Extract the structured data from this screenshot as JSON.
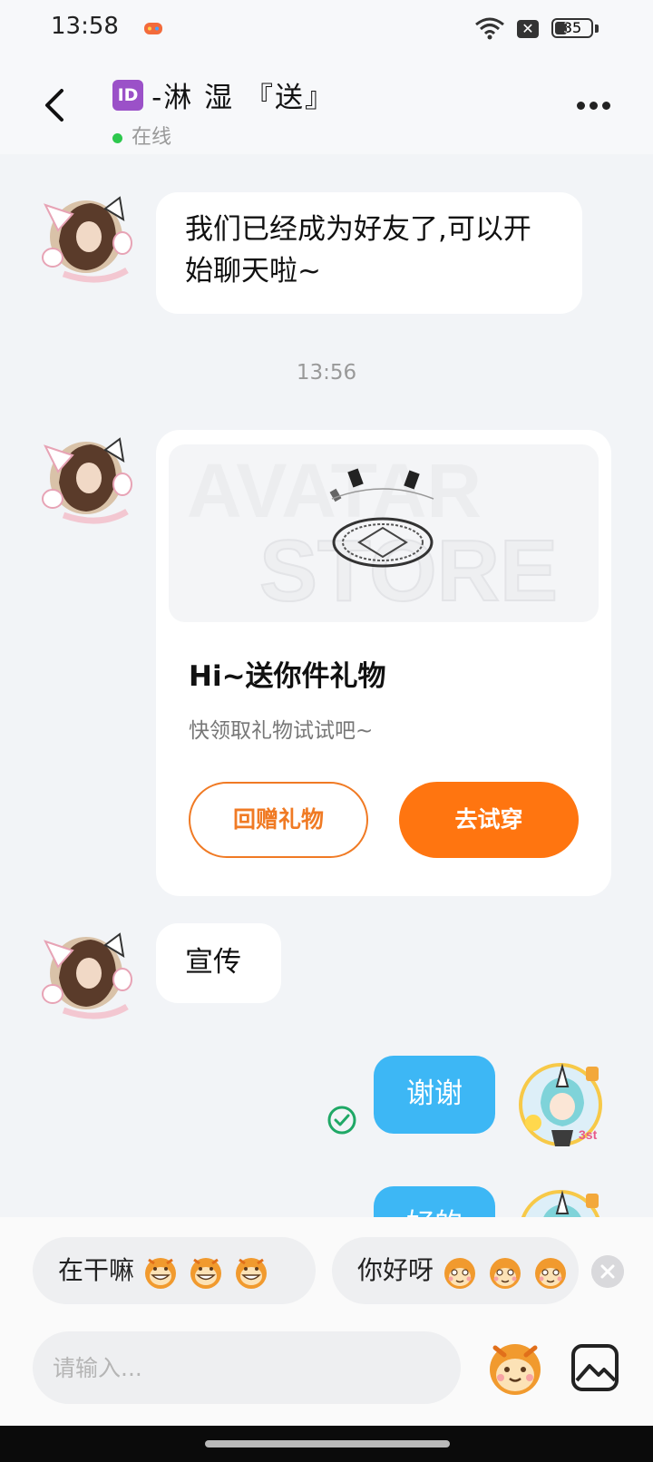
{
  "status_bar": {
    "time": "13:58",
    "battery": "35",
    "battery_level": 0.35
  },
  "header": {
    "id_badge": "ID",
    "title": "-淋  湿   『送』",
    "status": "在线"
  },
  "messages": {
    "m1": "我们已经成为好友了,可以开始聊天啦~",
    "timestamp": "13:56",
    "gift": {
      "image_text_1": "AVATAR",
      "image_text_2": "STORE",
      "title": "Hi~送你件礼物",
      "subtitle": "快领取礼物试试吧~",
      "return_button": "回赠礼物",
      "try_button": "去试穿"
    },
    "m2": "宣传",
    "mine1": "谢谢",
    "mine2": "好的"
  },
  "quick_replies": [
    "在干嘛",
    "你好呀"
  ],
  "composer": {
    "placeholder": "请输入..."
  },
  "colors": {
    "accent_orange": "#FF7510",
    "bubble_blue": "#3DB7F5",
    "online_green": "#2DC84D",
    "background": "#F2F4F7"
  },
  "icons": [
    "back-arrow-icon",
    "more-dots-icon",
    "read-check-icon",
    "close-icon",
    "sticker-icon",
    "image-icon",
    "wifi-icon",
    "battery-icon"
  ]
}
